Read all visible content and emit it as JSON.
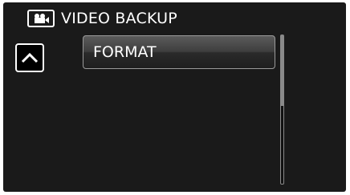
{
  "header": {
    "mode_icon": "video-camera-icon",
    "title": "VIDEO BACKUP"
  },
  "navigation": {
    "up_icon": "chevron-up-icon"
  },
  "menu": {
    "items": [
      {
        "label": "FORMAT",
        "selected": true
      }
    ]
  },
  "scrollbar": {
    "position_fraction": 0.0,
    "visible_fraction": 0.47
  },
  "colors": {
    "background": "#1a1a1a",
    "text": "#ffffff",
    "item_border": "#9a9a9a",
    "scrollbar": "#8a8a8a"
  }
}
